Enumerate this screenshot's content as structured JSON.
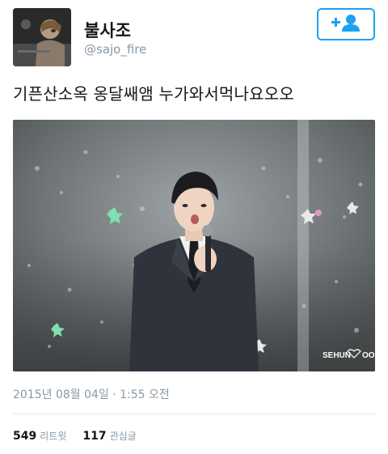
{
  "user": {
    "name": "불사조",
    "handle": "@sajo_fire"
  },
  "follow_button": {
    "icon": "add-user-icon"
  },
  "tweet": {
    "text": "기픈산소옥 옹달쌔앰 누가와서먹나요오오",
    "watermark_line1": "SEHUN",
    "watermark_line2": "OOH",
    "timestamp": "2015년 08월 04일 · 1:55 오전"
  },
  "stats": {
    "retweets_count": "549",
    "retweets_label": "리트윗",
    "likes_count": "117",
    "likes_label": "관심글"
  },
  "colors": {
    "accent": "#1da1f2",
    "muted": "#8899a6",
    "divider": "#e1e8ed"
  }
}
